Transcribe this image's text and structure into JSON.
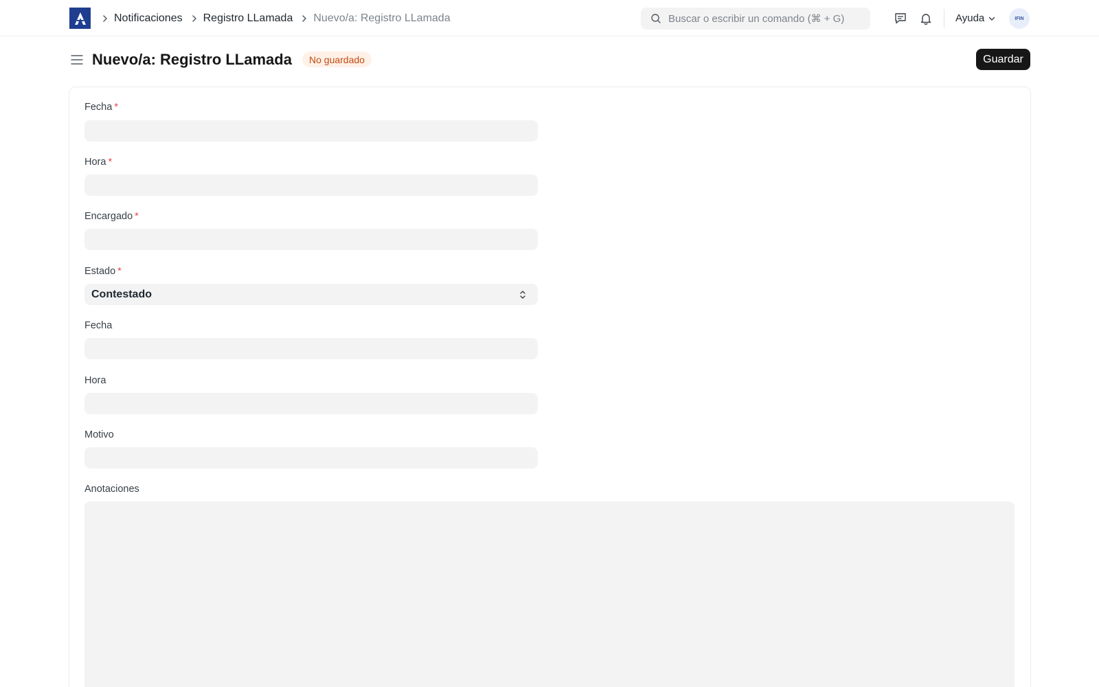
{
  "navbar": {
    "breadcrumbs": [
      "Notificaciones",
      "Registro LLamada",
      "Nuevo/a: Registro LLamada"
    ],
    "search_placeholder": "Buscar o escribir un comando (⌘ + G)",
    "help_label": "Ayuda",
    "avatar_initials": "IFIN",
    "logo_color": "#1f3e8f"
  },
  "page": {
    "title": "Nuevo/a: Registro LLamada",
    "status_badge": "No guardado",
    "save_label": "Guardar"
  },
  "form": {
    "fields": [
      {
        "label": "Fecha",
        "required": "*",
        "value": ""
      },
      {
        "label": "Hora",
        "required": "*",
        "value": ""
      },
      {
        "label": "Encargado",
        "required": "*",
        "value": ""
      },
      {
        "label": "Estado",
        "required": "*",
        "value": "Contestado"
      },
      {
        "label": "Fecha",
        "value": ""
      },
      {
        "label": "Hora",
        "value": ""
      },
      {
        "label": "Motivo",
        "value": ""
      },
      {
        "label": "Anotaciones",
        "value": ""
      }
    ]
  }
}
